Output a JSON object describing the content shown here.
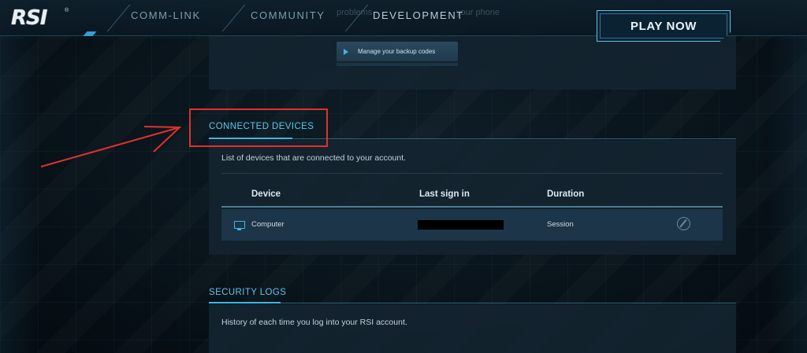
{
  "nav": {
    "logo": "RSI",
    "logo_reg": "®",
    "items": [
      "COMM-LINK",
      "COMMUNITY",
      "DEVELOPMENT"
    ],
    "ghost_text_left": "problems",
    "ghost_text_right": "your phone",
    "play_button": "PLAY NOW"
  },
  "top_panel": {
    "backup_button": "Manage your backup codes"
  },
  "connected_devices": {
    "title": "CONNECTED DEVICES",
    "description": "List of devices that are connected to your account.",
    "headers": {
      "device": "Device",
      "last_sign_in": "Last sign in",
      "duration": "Duration"
    },
    "rows": [
      {
        "device": "Computer",
        "last_sign_in": "",
        "duration": "Session",
        "icon": "monitor-icon"
      }
    ]
  },
  "security_logs": {
    "title": "SECURITY LOGS",
    "description": "History of each time you log into your RSI account."
  },
  "colors": {
    "accent": "#3fb5e6",
    "annotation": "#e0312c",
    "panel": "#132430"
  }
}
